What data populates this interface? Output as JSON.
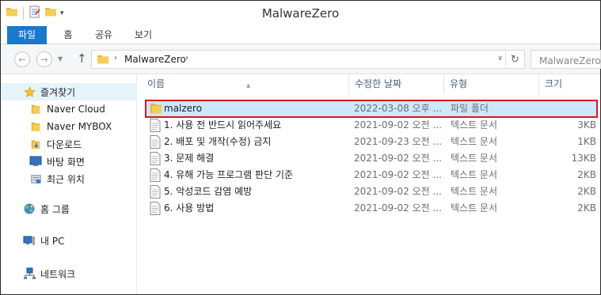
{
  "window": {
    "title": "MalwareZero"
  },
  "ribbon": {
    "tabs": [
      "파일",
      "홈",
      "공유",
      "보기"
    ]
  },
  "address": {
    "crumb": "MalwareZero",
    "search_placeholder": "MalwareZero 검색"
  },
  "nav": {
    "favorites": "즐겨찾기",
    "items": [
      "Naver Cloud",
      "Naver MYBOX",
      "다운로드",
      "바탕 화면",
      "최근 위치"
    ],
    "homegroup": "홈 그룹",
    "pc": "내 PC",
    "network": "네트워크"
  },
  "columns": {
    "name": "이름",
    "date": "수정한 날짜",
    "type": "유형",
    "size": "크기"
  },
  "files": [
    {
      "name": "malzero",
      "date": "2022-03-08 오후 ...",
      "type": "파일 폴더",
      "size": "",
      "icon": "folder-icon"
    },
    {
      "name": "1. 사용 전 반드시 읽어주세요",
      "date": "2021-09-02 오전 ...",
      "type": "텍스트 문서",
      "size": "3KB",
      "icon": "text-file-icon"
    },
    {
      "name": "2. 배포 및 개작(수정) 금지",
      "date": "2021-09-23 오전 ...",
      "type": "텍스트 문서",
      "size": "1KB",
      "icon": "text-file-icon"
    },
    {
      "name": "3. 문제 해결",
      "date": "2021-09-02 오전 ...",
      "type": "텍스트 문서",
      "size": "13KB",
      "icon": "text-file-icon"
    },
    {
      "name": "4. 유해 가능 프로그램 판단 기준",
      "date": "2021-09-02 오전 ...",
      "type": "텍스트 문서",
      "size": "2KB",
      "icon": "text-file-icon"
    },
    {
      "name": "5. 악성코드 감염 예방",
      "date": "2021-09-02 오전 ...",
      "type": "텍스트 문서",
      "size": "2KB",
      "icon": "text-file-icon"
    },
    {
      "name": "6. 사용 방법",
      "date": "2021-09-02 오전 ...",
      "type": "텍스트 문서",
      "size": "2KB",
      "icon": "text-file-icon"
    }
  ],
  "colors": {
    "accent": "#1979ca",
    "selection": "#cce8ff",
    "highlight_box": "#e0141e",
    "folder": "#e8b735"
  }
}
